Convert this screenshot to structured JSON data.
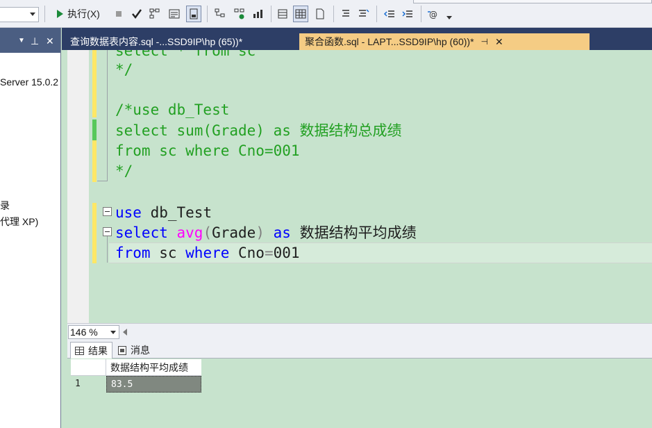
{
  "toolbar": {
    "execute_label": "执行(X)"
  },
  "left_panel": {
    "items": [
      "Server 15.0.2",
      "录",
      "代理 XP)"
    ]
  },
  "tabs": [
    {
      "label": "查询数据表内容.sql -...SSD9IP\\hp (65))*"
    },
    {
      "label": "聚合函数.sql - LAPT...SSD9IP\\hp (60))*"
    }
  ],
  "editor": {
    "lines": [
      "select * from sc",
      "*/",
      "",
      "/*use db_Test",
      "select sum(Grade) as 数据结构总成绩",
      "from sc where Cno=001",
      "*/",
      "",
      "use db_Test",
      "select avg(Grade) as 数据结构平均成绩",
      "from sc where Cno=001"
    ]
  },
  "zoom": "146 %",
  "results": {
    "tabs": [
      "结果",
      "消息"
    ],
    "column": "数据结构平均成绩",
    "row_number": "1",
    "value": "83.5"
  }
}
